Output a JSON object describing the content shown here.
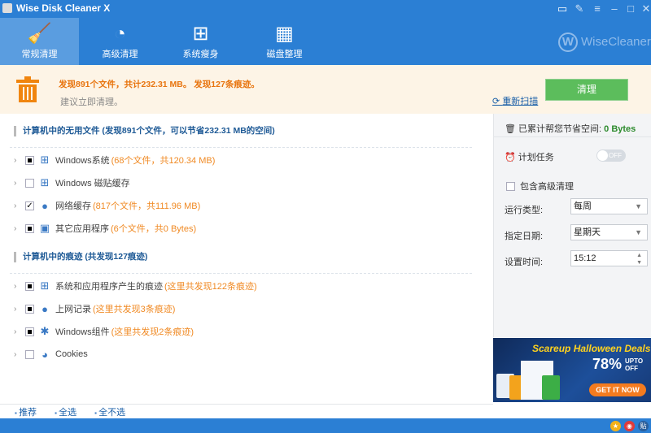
{
  "app": {
    "title": "Wise Disk Cleaner X",
    "logo_text": "WiseCleaner"
  },
  "tabs": [
    {
      "label": "常规清理",
      "icon": "broom-icon",
      "active": true
    },
    {
      "label": "高级清理",
      "icon": "vacuum-icon"
    },
    {
      "label": "系统瘦身",
      "icon": "windows-icon"
    },
    {
      "label": "磁盘整理",
      "icon": "defrag-icon"
    }
  ],
  "banner": {
    "found": "发现891个文件，共计232.31 MB。 发现127条痕迹。",
    "suggest": "建议立即清理。",
    "rescan": "重新扫描",
    "clean": "清理"
  },
  "sections": [
    {
      "title": "计算机中的无用文件 (发现891个文件，可以节省232.31 MB的空间)",
      "items": [
        {
          "name": "Windows系统",
          "detail": "(68个文件，共120.34 MB)",
          "state": "partial",
          "icon": "windows-icon"
        },
        {
          "name": "Windows 磁贴缓存",
          "detail": "",
          "state": "unchecked",
          "icon": "windows-icon"
        },
        {
          "name": "网络缓存",
          "detail": "(817个文件，共111.96 MB)",
          "state": "checked",
          "icon": "globe-icon"
        },
        {
          "name": "其它应用程序",
          "detail": "(6个文件，共0 Bytes)",
          "state": "partial",
          "icon": "package-icon"
        }
      ]
    },
    {
      "title": "计算机中的痕迹 (共发现127痕迹)",
      "items": [
        {
          "name": "系统和应用程序产生的痕迹",
          "detail": "(这里共发现122条痕迹)",
          "state": "partial",
          "icon": "windows-icon"
        },
        {
          "name": "上网记录",
          "detail": "(这里共发现3条痕迹)",
          "state": "partial",
          "icon": "globe-icon"
        },
        {
          "name": "Windows组件",
          "detail": "(这里共发现2条痕迹)",
          "state": "partial",
          "icon": "puzzle-icon"
        },
        {
          "name": "Cookies",
          "detail": "",
          "state": "unchecked",
          "icon": "cookie-icon"
        }
      ]
    }
  ],
  "side": {
    "saved_label": "已累计帮您节省空间:",
    "saved_value": "0 Bytes",
    "schedule": "计划任务",
    "toggle": "OFF",
    "include_adv": "包含高级清理",
    "run_type_label": "运行类型:",
    "run_type": "每周",
    "day_label": "指定日期:",
    "day": "星期天",
    "time_label": "设置时间:",
    "time": "15:12"
  },
  "ad": {
    "title": "Scareup Halloween Deals",
    "percent": "78%",
    "upto": "UPTO",
    "off": "OFF",
    "cta": "GET IT NOW"
  },
  "bottom": {
    "recommend": "推荐",
    "select_all": "全选",
    "select_none": "全不选"
  },
  "colors": {
    "primary": "#2b7fd4",
    "accent": "#e8740e",
    "clean": "#5cbd5c"
  }
}
